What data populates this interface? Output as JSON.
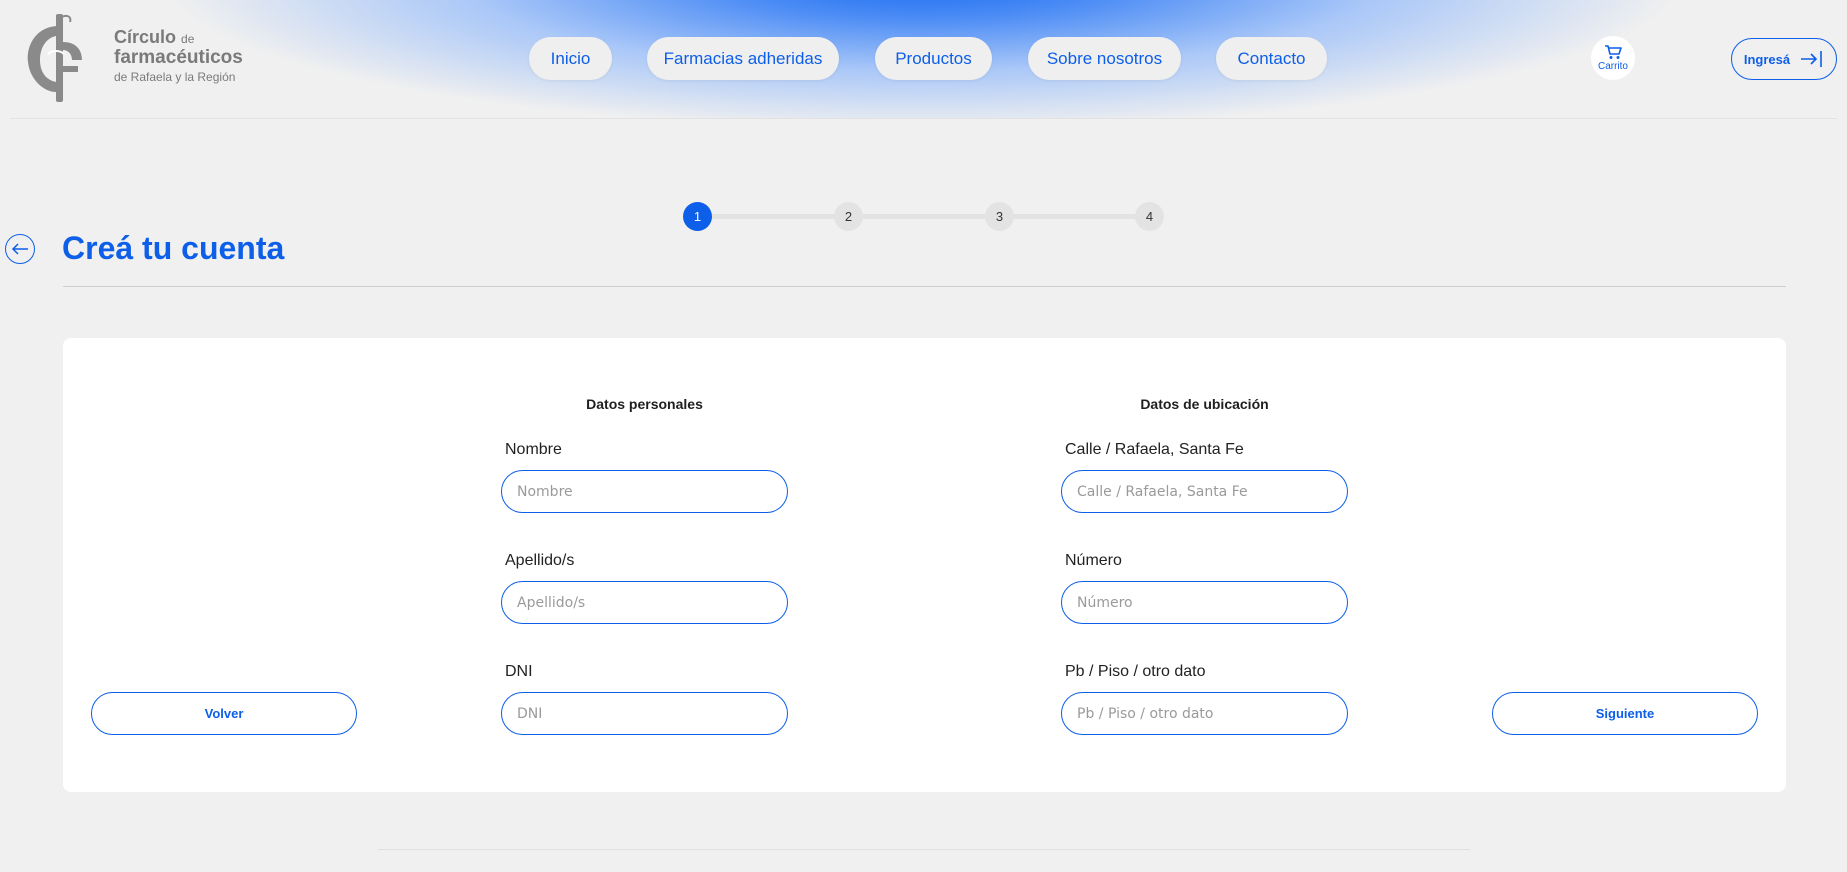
{
  "brand": {
    "line1": "Círculo",
    "line1_suffix": "de",
    "line2": "farmacéuticos",
    "line3": "de Rafaela y la Región"
  },
  "nav": {
    "items": [
      {
        "label": "Inicio"
      },
      {
        "label": "Farmacias adheridas"
      },
      {
        "label": "Productos"
      },
      {
        "label": "Sobre nosotros"
      },
      {
        "label": "Contacto"
      }
    ],
    "cart_label": "Carrito",
    "login_label": "Ingresá"
  },
  "stepper": {
    "steps": [
      "1",
      "2",
      "3",
      "4"
    ],
    "active": 1
  },
  "page": {
    "title": "Creá tu cuenta"
  },
  "form": {
    "personal_title": "Datos personales",
    "location_title": "Datos de ubicación",
    "fields": {
      "nombre": {
        "label": "Nombre",
        "placeholder": "Nombre",
        "value": ""
      },
      "apellido": {
        "label": "Apellido/s",
        "placeholder": "Apellido/s",
        "value": ""
      },
      "dni": {
        "label": "DNI",
        "placeholder": "DNI",
        "value": ""
      },
      "calle": {
        "label": "Calle / Rafaela, Santa Fe",
        "placeholder": "Calle / Rafaela, Santa Fe",
        "value": ""
      },
      "numero": {
        "label": "Número",
        "placeholder": "Número",
        "value": ""
      },
      "piso": {
        "label": "Pb / Piso / otro dato",
        "placeholder": "Pb / Piso / otro dato",
        "value": ""
      }
    },
    "back_label": "Volver",
    "next_label": "Siguiente"
  },
  "colors": {
    "accent": "#0d5ee8",
    "background": "#f0f0f0",
    "card": "#ffffff"
  },
  "icons": [
    "logo-mark",
    "cart-icon",
    "login-arrow-icon",
    "back-arrow-icon"
  ]
}
